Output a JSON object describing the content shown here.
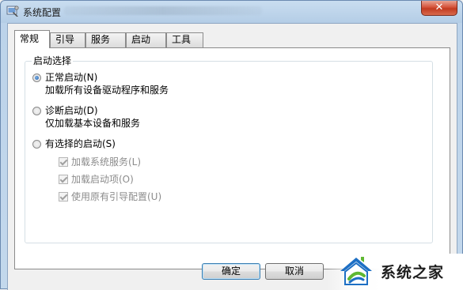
{
  "window": {
    "title": "系统配置",
    "close_glyph": "✕"
  },
  "tabs": [
    {
      "label": "常规",
      "active": true
    },
    {
      "label": "引导",
      "active": false
    },
    {
      "label": "服务",
      "active": false
    },
    {
      "label": "启动",
      "active": false
    },
    {
      "label": "工具",
      "active": false
    }
  ],
  "startup_group": {
    "legend": "启动选择",
    "options": [
      {
        "label": "正常启动(N)",
        "description": "加载所有设备驱动程序和服务",
        "selected": true
      },
      {
        "label": "诊断启动(D)",
        "description": "仅加载基本设备和服务",
        "selected": false
      },
      {
        "label": "有选择的启动(S)",
        "description": "",
        "selected": false
      }
    ],
    "selective_items": [
      {
        "label": "加载系统服务(L)",
        "checked": true,
        "enabled": false
      },
      {
        "label": "加载启动项(O)",
        "checked": true,
        "enabled": false
      },
      {
        "label": "使用原有引导配置(U)",
        "checked": true,
        "enabled": false
      }
    ]
  },
  "buttons": {
    "ok": "确定",
    "cancel": "取消"
  },
  "watermark": {
    "text": "系统之家"
  },
  "colors": {
    "title_bar": "#b4cde6",
    "close_button": "#c23a20",
    "radio_selected": "#1e5aa8",
    "disabled_text": "#8c8c8c",
    "watermark_blue": "#1d6fc4",
    "watermark_green": "#5fb832"
  }
}
